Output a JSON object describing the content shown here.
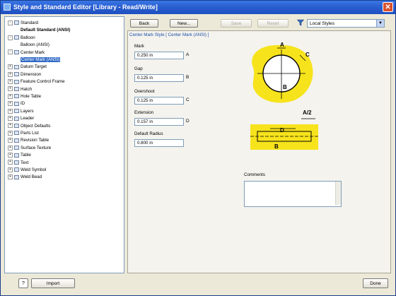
{
  "window": {
    "title": "Style and Standard Editor [Library - Read/Write]"
  },
  "tree": {
    "items": [
      {
        "label": "Standard",
        "expander": "-",
        "icon": "standard-icon",
        "indent": 0,
        "bold": false
      },
      {
        "label": "Default Standard (ANSI)",
        "expander": "",
        "icon": "",
        "indent": 1,
        "bold": true
      },
      {
        "label": "Balloon",
        "expander": "-",
        "icon": "balloon-icon",
        "indent": 0,
        "bold": false
      },
      {
        "label": "Balloon (ANSI)",
        "expander": "",
        "icon": "",
        "indent": 1,
        "bold": false
      },
      {
        "label": "Center Mark",
        "expander": "-",
        "icon": "center-mark-icon",
        "indent": 0,
        "bold": false
      },
      {
        "label": "Center Mark (ANSI)",
        "expander": "",
        "icon": "",
        "indent": 1,
        "bold": false,
        "selected": true
      },
      {
        "label": "Datum Target",
        "expander": "+",
        "icon": "datum-target-icon",
        "indent": 0,
        "bold": false
      },
      {
        "label": "Dimension",
        "expander": "+",
        "icon": "dimension-icon",
        "indent": 0,
        "bold": false
      },
      {
        "label": "Feature Control Frame",
        "expander": "+",
        "icon": "feature-control-frame-icon",
        "indent": 0,
        "bold": false
      },
      {
        "label": "Hatch",
        "expander": "+",
        "icon": "hatch-icon",
        "indent": 0,
        "bold": false
      },
      {
        "label": "Hole Table",
        "expander": "+",
        "icon": "hole-table-icon",
        "indent": 0,
        "bold": false
      },
      {
        "label": "ID",
        "expander": "+",
        "icon": "id-icon",
        "indent": 0,
        "bold": false
      },
      {
        "label": "Layers",
        "expander": "+",
        "icon": "layers-icon",
        "indent": 0,
        "bold": false
      },
      {
        "label": "Leader",
        "expander": "+",
        "icon": "leader-icon",
        "indent": 0,
        "bold": false
      },
      {
        "label": "Object Defaults",
        "expander": "+",
        "icon": "object-defaults-icon",
        "indent": 0,
        "bold": false
      },
      {
        "label": "Parts List",
        "expander": "+",
        "icon": "parts-list-icon",
        "indent": 0,
        "bold": false
      },
      {
        "label": "Revision Table",
        "expander": "+",
        "icon": "revision-table-icon",
        "indent": 0,
        "bold": false
      },
      {
        "label": "Surface Texture",
        "expander": "+",
        "icon": "surface-texture-icon",
        "indent": 0,
        "bold": false
      },
      {
        "label": "Table",
        "expander": "+",
        "icon": "table-icon",
        "indent": 0,
        "bold": false
      },
      {
        "label": "Text",
        "expander": "+",
        "icon": "text-icon",
        "indent": 0,
        "bold": false
      },
      {
        "label": "Weld Symbol",
        "expander": "+",
        "icon": "weld-symbol-icon",
        "indent": 0,
        "bold": false
      },
      {
        "label": "Weld Bead",
        "expander": "+",
        "icon": "weld-bead-icon",
        "indent": 0,
        "bold": false
      }
    ]
  },
  "toolbar": {
    "back_label": "Back",
    "new_label": "New...",
    "save_label": "Save",
    "reset_label": "Reset",
    "filter_icon": "filter-icon",
    "filter_value": "Local Styles"
  },
  "editor": {
    "tab_label": "Center Mark Style [ Center Mark (ANSI) ]",
    "fields": [
      {
        "label": "Mark",
        "value": "0.250 in",
        "spin_label": "A"
      },
      {
        "label": "Gap",
        "value": "0.125 in",
        "spin_label": "B"
      },
      {
        "label": "Overshoot",
        "value": "0.125 in",
        "spin_label": "C"
      },
      {
        "label": "Extension",
        "value": "0.157 in",
        "spin_label": "D"
      },
      {
        "label": "Default Radius",
        "value": "0.800 in",
        "spin_label": ""
      }
    ],
    "diagram": {
      "labels": {
        "a": "A",
        "b": "B",
        "c": "C",
        "d": "D",
        "half_a": "A/2"
      },
      "highlight_color": "#f7e31c"
    },
    "comments_label": "Comments",
    "comments_value": ""
  },
  "footer": {
    "help_label": "?",
    "import_label": "Import",
    "done_label": "Done"
  }
}
